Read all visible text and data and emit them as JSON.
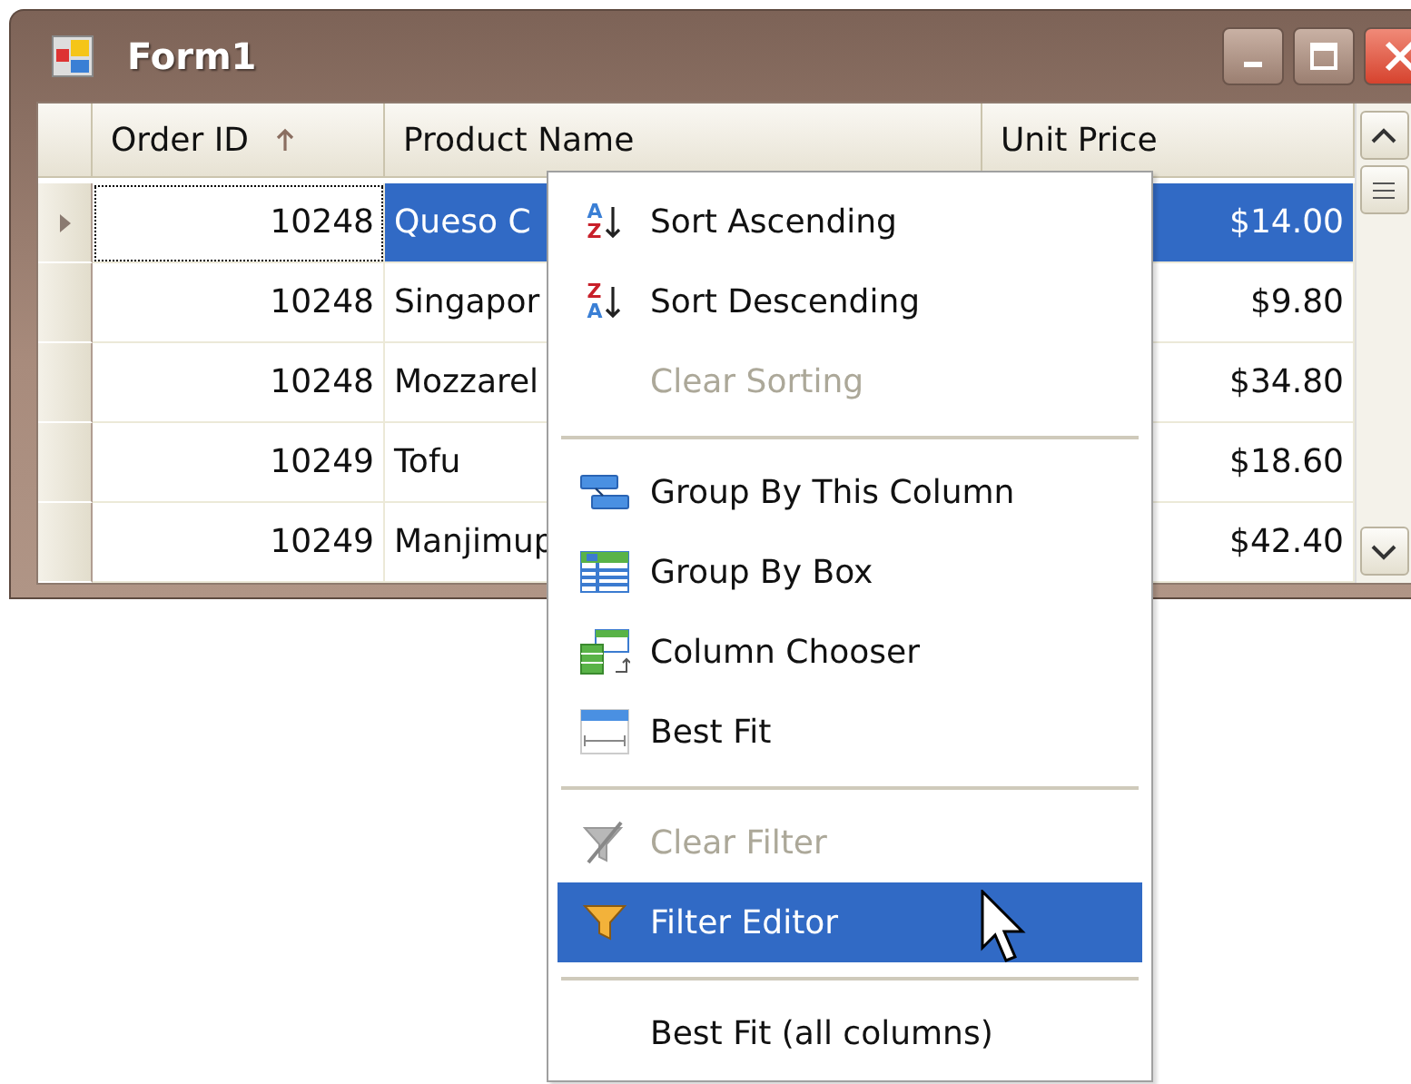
{
  "window": {
    "title": "Form1"
  },
  "grid": {
    "columns": [
      {
        "label": "Order ID",
        "sorted": true
      },
      {
        "label": "Product Name",
        "sorted": false
      },
      {
        "label": "Unit Price",
        "sorted": false
      }
    ],
    "rows": [
      {
        "selected": true,
        "cells": [
          "10248",
          "Queso C",
          "$14.00"
        ]
      },
      {
        "selected": false,
        "cells": [
          "10248",
          "Singapor",
          "$9.80"
        ]
      },
      {
        "selected": false,
        "cells": [
          "10248",
          "Mozzarel",
          "$34.80"
        ]
      },
      {
        "selected": false,
        "cells": [
          "10249",
          "Tofu",
          "$18.60"
        ]
      },
      {
        "selected": false,
        "cells": [
          "10249",
          "Manjimup",
          "$42.40"
        ]
      }
    ]
  },
  "context_menu": {
    "items": [
      {
        "kind": "item",
        "icon_letters": [
          "A",
          "Z"
        ],
        "label": "Sort Ascending",
        "disabled": false,
        "selected": false
      },
      {
        "kind": "item",
        "icon_letters": [
          "Z",
          "A"
        ],
        "label": "Sort Descending",
        "disabled": false,
        "selected": false
      },
      {
        "kind": "item",
        "label": "Clear Sorting",
        "disabled": true,
        "selected": false
      },
      {
        "kind": "separator"
      },
      {
        "kind": "item",
        "label": "Group By This Column",
        "disabled": false,
        "selected": false
      },
      {
        "kind": "item",
        "label": "Group By Box",
        "disabled": false,
        "selected": false
      },
      {
        "kind": "item",
        "label": "Column Chooser",
        "disabled": false,
        "selected": false
      },
      {
        "kind": "item",
        "label": "Best Fit",
        "disabled": false,
        "selected": false
      },
      {
        "kind": "separator"
      },
      {
        "kind": "item",
        "label": "Clear Filter",
        "disabled": true,
        "selected": false
      },
      {
        "kind": "item",
        "label": "Filter Editor",
        "disabled": false,
        "selected": true
      },
      {
        "kind": "separator"
      },
      {
        "kind": "item",
        "label": "Best Fit (all columns)",
        "disabled": false,
        "selected": false
      }
    ]
  }
}
